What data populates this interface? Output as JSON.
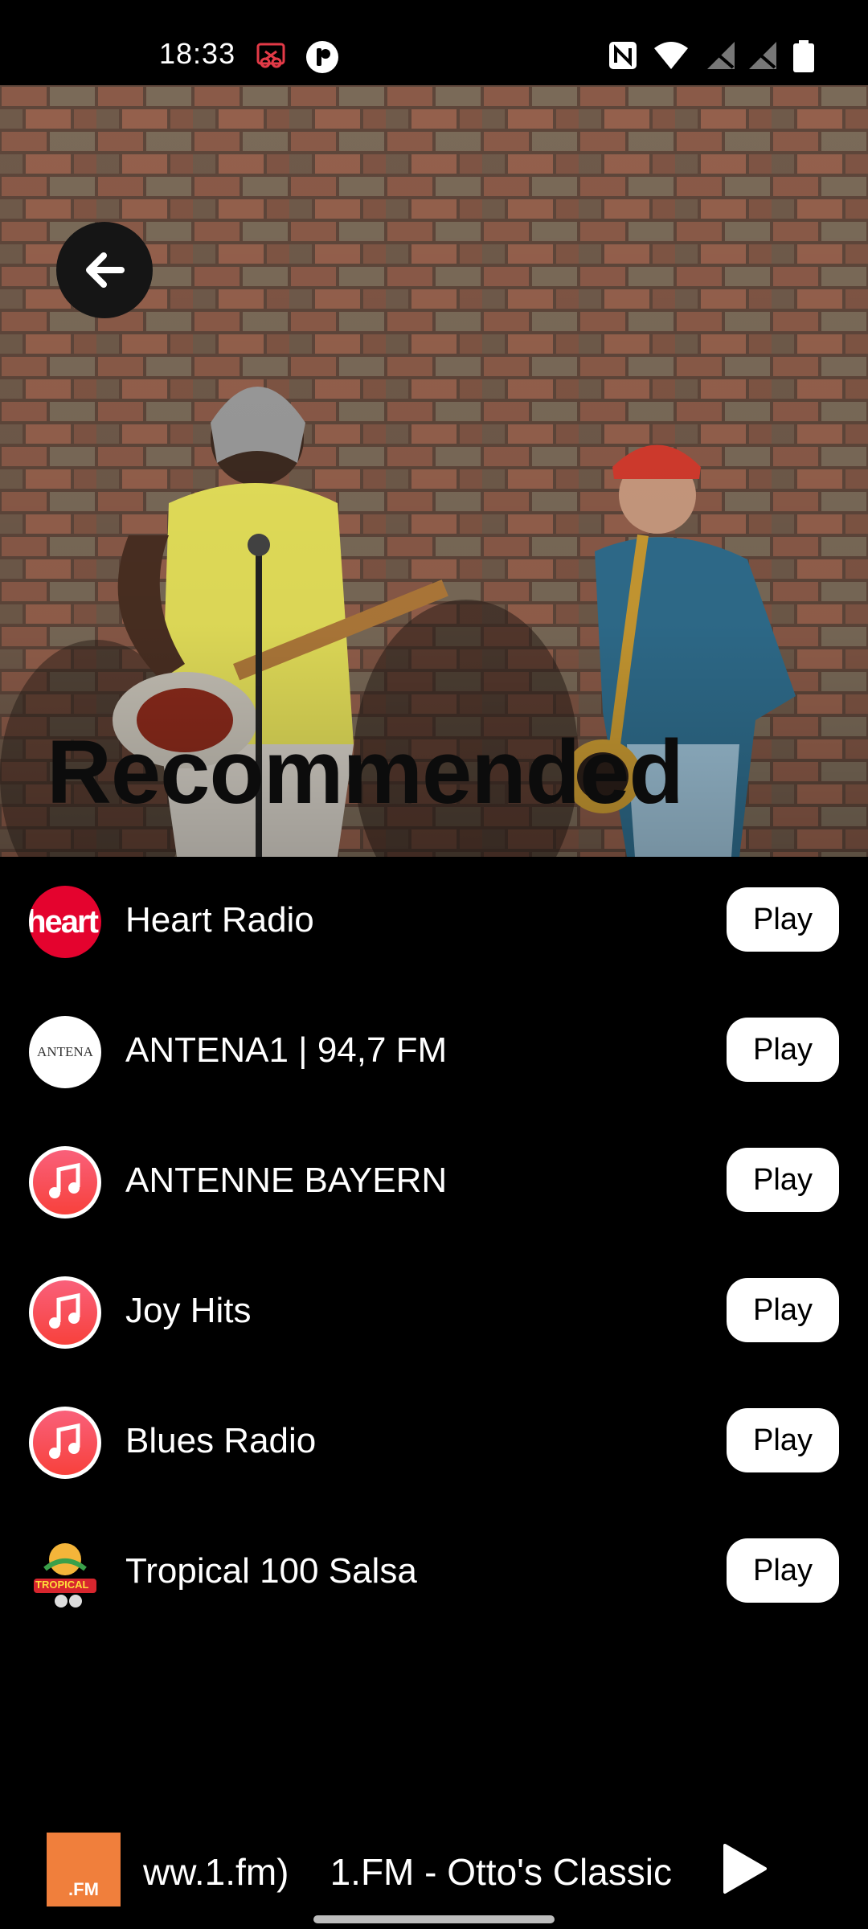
{
  "status_bar": {
    "time": "18:33",
    "icons": [
      "screen-record-icon",
      "app-notification-icon",
      "nfc-icon",
      "wifi-icon",
      "signal-1-icon",
      "signal-2-icon",
      "battery-icon"
    ]
  },
  "hero": {
    "title": "Recommended",
    "back_icon": "arrow-left-icon"
  },
  "stations": [
    {
      "name": "Heart Radio",
      "play_label": "Play",
      "logo": "heart-logo",
      "logo_text": "heart"
    },
    {
      "name": "ANTENA1 | 94,7 FM",
      "play_label": "Play",
      "logo": "antena1-logo",
      "logo_text": "ANTENA"
    },
    {
      "name": "ANTENNE BAYERN",
      "play_label": "Play",
      "logo": "music-note-icon"
    },
    {
      "name": "Joy Hits",
      "play_label": "Play",
      "logo": "music-note-icon"
    },
    {
      "name": "Blues Radio",
      "play_label": "Play",
      "logo": "music-note-icon"
    },
    {
      "name": "Tropical 100 Salsa",
      "play_label": "Play",
      "logo": "tropical-logo",
      "logo_text": "TROPICAL"
    }
  ],
  "mini_player": {
    "art_text": ".FM",
    "now_playing": "ww.1.fm)    1.FM - Otto's Classic",
    "play_icon": "play-icon"
  },
  "colors": {
    "background": "#000000",
    "play_button": "#ffffff",
    "music_gradient_start": "#f9607a",
    "music_gradient_end": "#f8413c",
    "heart_red": "#e4032e"
  }
}
